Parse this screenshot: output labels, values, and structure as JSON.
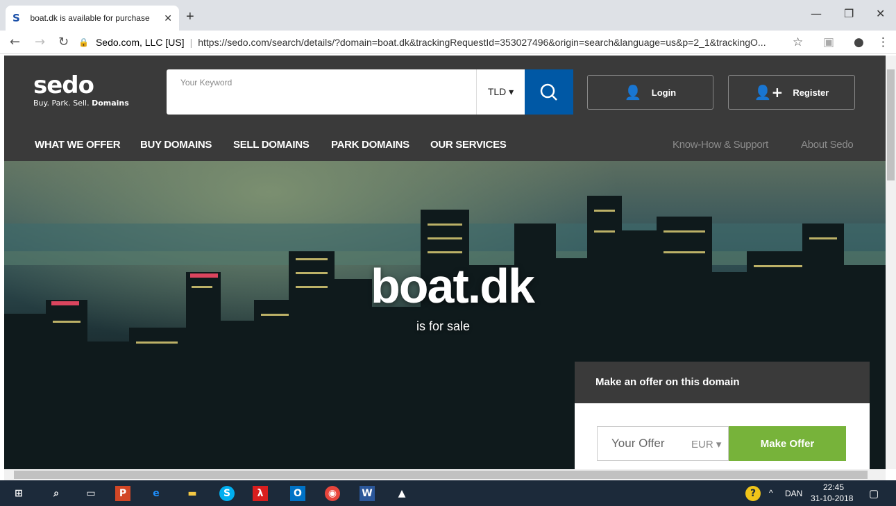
{
  "browser": {
    "tab_title": "boat.dk is available for purchase",
    "tab_favicon": "S",
    "url_owner": "Sedo.com, LLC [US]",
    "url_text": "https://sedo.com/search/details/?domain=boat.dk&trackingRequestId=353027496&origin=search&language=us&p=2_1&trackingO..."
  },
  "header": {
    "logo_word": "sedo",
    "logo_tag_prefix": "Buy. Park. Sell.",
    "logo_tag_bold": "Domains",
    "search_placeholder": "Your Keyword",
    "tld_label": "TLD ▾",
    "login_label": "Login",
    "register_label": "Register"
  },
  "nav": {
    "main": [
      "WHAT WE OFFER",
      "BUY DOMAINS",
      "SELL DOMAINS",
      "PARK DOMAINS",
      "OUR SERVICES"
    ],
    "secondary": [
      "Know-How & Support",
      "About Sedo"
    ]
  },
  "hero": {
    "domain": "boat.dk",
    "subtitle": "is for sale"
  },
  "offer": {
    "heading": "Make an offer on this domain",
    "input_placeholder": "Your Offer",
    "currency": "EUR",
    "button_label": "Make Offer"
  },
  "taskbar": {
    "language": "DAN",
    "time": "22:45",
    "date": "31-10-2018"
  },
  "colors": {
    "header_bg": "#3a3a3a",
    "search_button": "#0058a5",
    "offer_button": "#77b33a",
    "taskbar_bg": "#1c2a3a"
  }
}
